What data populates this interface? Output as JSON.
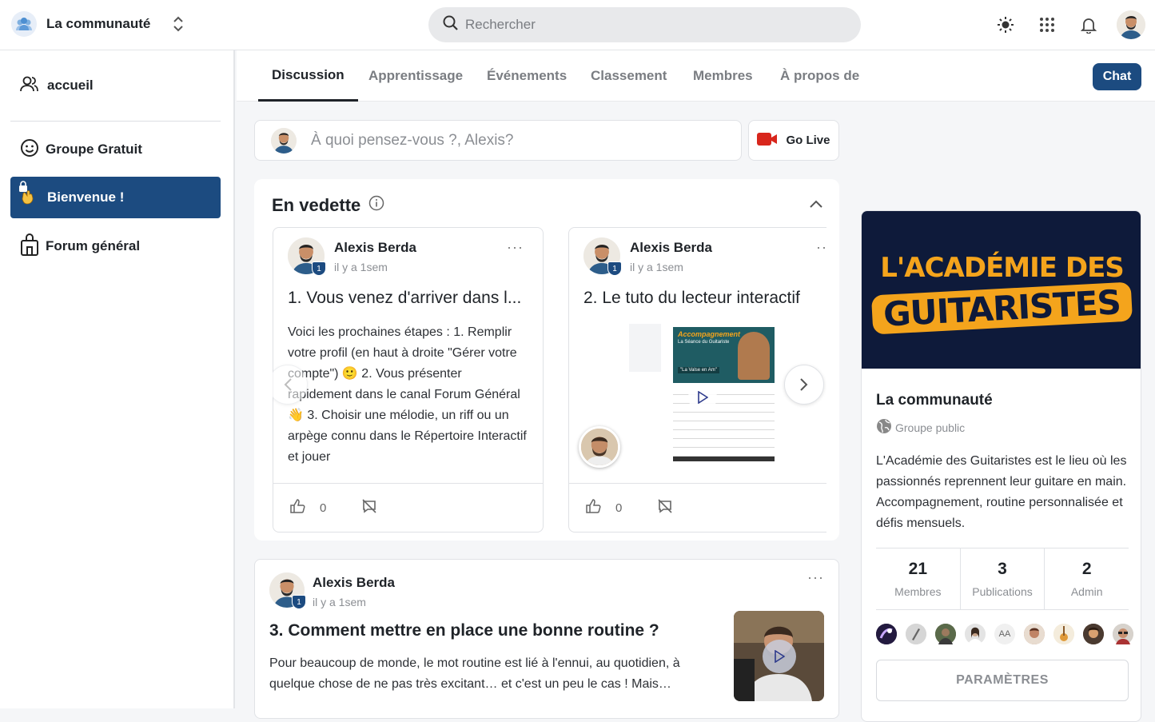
{
  "header": {
    "community_name": "La communauté",
    "search_placeholder": "Rechercher"
  },
  "sidebar": {
    "items": [
      {
        "label": "accueil",
        "icon": "user-icon"
      },
      {
        "label": "Groupe Gratuit",
        "icon": "smiley-icon"
      },
      {
        "label": "Bienvenue !",
        "icon": "wave-hand-icon",
        "active": true
      },
      {
        "label": "Forum général",
        "icon": "lock-icon"
      }
    ]
  },
  "tabs": [
    {
      "label": "Discussion",
      "active": true
    },
    {
      "label": "Apprentissage"
    },
    {
      "label": "Événements"
    },
    {
      "label": "Classement"
    },
    {
      "label": "Membres"
    },
    {
      "label": "À propos de"
    }
  ],
  "chat_label": "Chat",
  "composer": {
    "placeholder": "À quoi pensez-vous ?, Alexis?",
    "go_live_label": "Go Live"
  },
  "featured": {
    "title": "En vedette",
    "cards": [
      {
        "author": "Alexis Berda",
        "time": "il y a 1sem",
        "badge": "1",
        "title": "1. Vous venez d'arriver dans l...",
        "body": "Voici les prochaines étapes :  1. Remplir votre profil (en haut à droite \"Gérer votre compte\") 🙂 2. Vous présenter rapidement dans le canal Forum Général 👋 3. Choisir une mélodie, un riff ou un arpège connu dans le Répertoire Interactif et jouer",
        "likes": "0"
      },
      {
        "author": "Alexis Berda",
        "time": "il y a 1sem",
        "badge": "1",
        "title": "2. Le tuto du lecteur interactif",
        "video_title": "Accompagnement",
        "video_subtitle": "La Séance du Guitariste",
        "video_caption": "\"La Valse en Am\"",
        "likes": "0"
      }
    ]
  },
  "post": {
    "author": "Alexis Berda",
    "time": "il y a 1sem",
    "badge": "1",
    "title": "3. Comment mettre en place une bonne routine ?",
    "body": "Pour beaucoup de monde, le mot routine est lié à l'ennui, au quotidien, à quelque chose de ne pas très excitant… et c'est un peu le cas ! Mais…"
  },
  "community": {
    "banner_line1": "L'ACADÉMIE DES",
    "banner_line2": "GUITARISTES",
    "name": "La communauté",
    "type": "Groupe public",
    "description": "L'Académie des Guitaristes est le lieu où les passionnés reprennent leur guitare en main. Accompagnement, routine personnalisée et défis mensuels.",
    "stats": [
      {
        "value": "21",
        "label": "Membres"
      },
      {
        "value": "3",
        "label": "Publications"
      },
      {
        "value": "2",
        "label": "Admin"
      }
    ],
    "member_initials": "AA",
    "settings_label": "PARAMÈTRES"
  },
  "colors": {
    "accent": "#1c4b80",
    "brand_orange": "#f4a41c",
    "brand_navy": "#0e1a3a",
    "live_red": "#d8261c"
  }
}
